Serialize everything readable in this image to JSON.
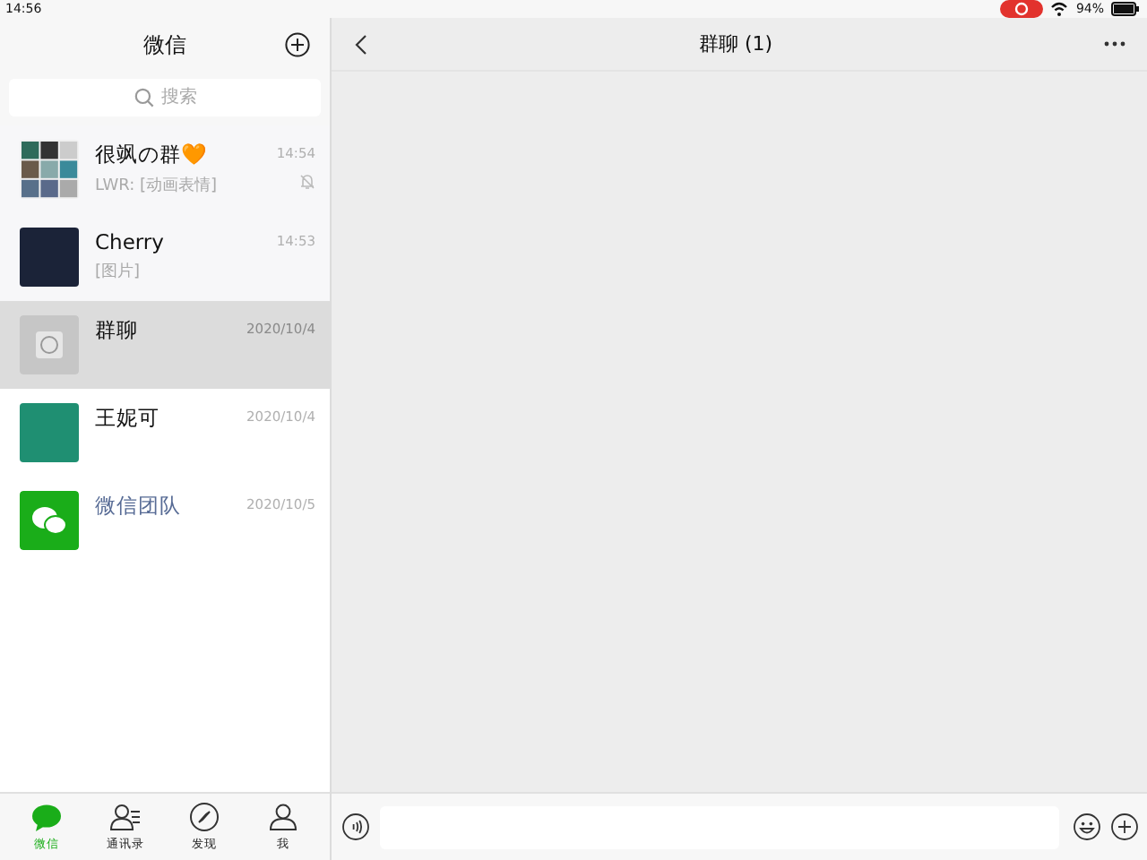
{
  "status_bar": {
    "time": "14:56",
    "battery": "94%"
  },
  "sidebar": {
    "title": "微信",
    "search": {
      "placeholder": "搜索"
    },
    "chats": [
      {
        "name": "很飒の群🧡",
        "preview": "LWR: [动画表情]",
        "time": "14:54",
        "kind": "grid",
        "pinned": true,
        "muted": true,
        "selected": false
      },
      {
        "name": "Cherry",
        "preview": "[图片]",
        "time": "14:53",
        "kind": "photo",
        "pinned": true,
        "muted": false,
        "selected": false
      },
      {
        "name": "群聊",
        "time": "2020/10/4",
        "kind": "group",
        "pinned": false,
        "muted": false,
        "selected": true
      },
      {
        "name": "王妮可",
        "time": "2020/10/4",
        "kind": "photo",
        "pinned": false,
        "muted": false,
        "selected": false
      },
      {
        "name": "微信团队",
        "time": "2020/10/5",
        "kind": "official",
        "pinned": false,
        "muted": false,
        "selected": false
      }
    ],
    "tabs": [
      {
        "label": "微信",
        "kind": "chat",
        "selected": true
      },
      {
        "label": "通讯录",
        "kind": "contacts",
        "selected": false
      },
      {
        "label": "发现",
        "kind": "compass",
        "selected": false
      },
      {
        "label": "我",
        "kind": "person",
        "selected": false
      }
    ]
  },
  "chat": {
    "title": "群聊 (1)"
  }
}
